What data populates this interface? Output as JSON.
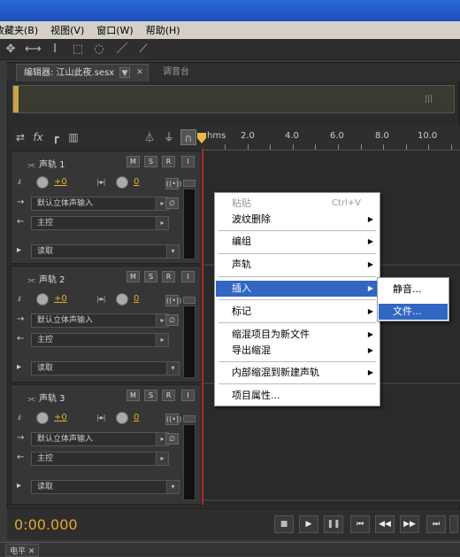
{
  "menubar": [
    "收藏夹(B)",
    "视图(V)",
    "窗口(W)",
    "帮助(H)"
  ],
  "tabs": {
    "editor": "编辑器: 江山此夜.sesx",
    "mixer": "调音台"
  },
  "ruler": {
    "unit": "hms",
    "labels": [
      "2.0",
      "4.0",
      "6.0",
      "8.0",
      "10.0"
    ]
  },
  "tracks": [
    {
      "name": "声轨 1",
      "vol": "+0",
      "pan": "0",
      "input": "默认立体声输入",
      "output": "主控",
      "mode": "读取"
    },
    {
      "name": "声轨 2",
      "vol": "+0",
      "pan": "0",
      "input": "默认立体声输入",
      "output": "主控",
      "mode": "读取"
    },
    {
      "name": "声轨 3",
      "vol": "+0",
      "pan": "0",
      "input": "默认立体声输入",
      "output": "主控",
      "mode": "读取"
    }
  ],
  "track_buttons": {
    "m": "M",
    "s": "S",
    "r": "R",
    "i": "I"
  },
  "transport": {
    "timecode": "0:00.000"
  },
  "context_menu": {
    "paste": "粘贴",
    "paste_shortcut": "Ctrl+V",
    "ripple_delete": "波纹删除",
    "group": "编组",
    "track": "声轨",
    "insert": "插入",
    "marker": "标记",
    "mixdown_new_file": "缩混项目为新文件",
    "export_mixdown": "导出缩混",
    "bounce_new_track": "内部缩混到新建声轨",
    "session_properties": "项目属性..."
  },
  "submenu": {
    "silence": "静音...",
    "file": "文件..."
  },
  "bottom_tab": "电平"
}
